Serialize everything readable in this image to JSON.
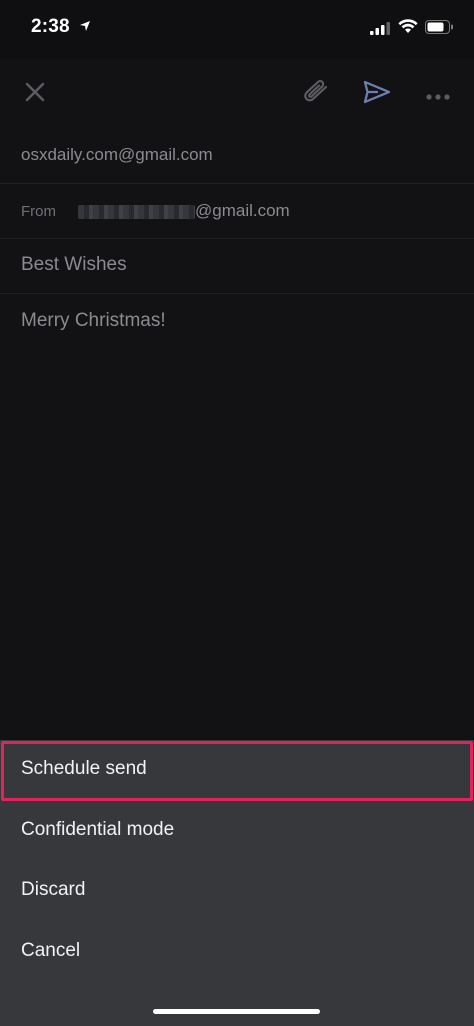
{
  "status_bar": {
    "time": "2:38"
  },
  "toolbar": {
    "icons": [
      "close-icon",
      "paperclip-icon",
      "send-icon",
      "more-horizontal-icon"
    ],
    "send_color": "#6b7fb0"
  },
  "compose": {
    "to": "osxdaily.com@gmail.com",
    "from_label": "From",
    "from_domain": "@gmail.com",
    "subject": "Best Wishes",
    "body": "Merry Christmas!"
  },
  "action_sheet": {
    "items": [
      {
        "label": "Schedule send",
        "highlighted": true
      },
      {
        "label": "Confidential mode"
      },
      {
        "label": "Discard"
      },
      {
        "label": "Cancel"
      }
    ],
    "highlight_color": "#e3245c"
  }
}
